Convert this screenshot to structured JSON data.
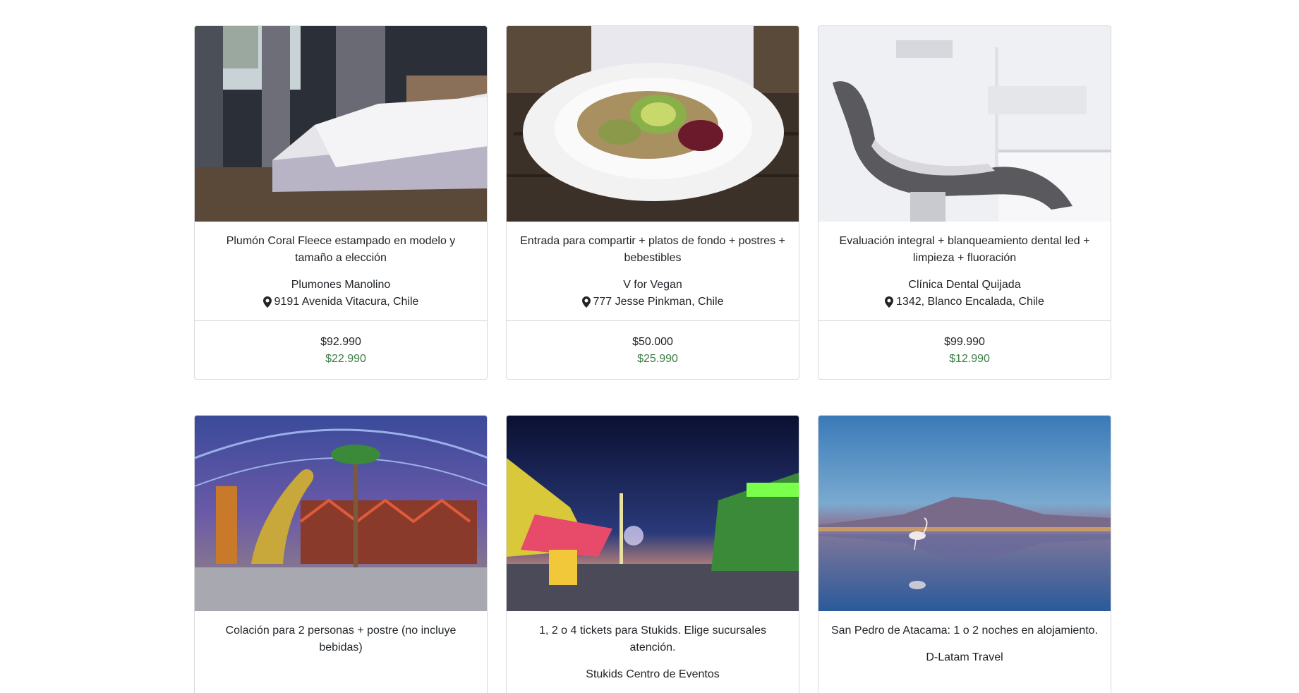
{
  "deals": [
    {
      "image": "bedroom-photo",
      "title": "Plumón Coral Fleece estampado en modelo y tamaño a elección",
      "merchant": "Plumones Manolino",
      "location": "9191 Avenida Vitacura, Chile",
      "price_old": "$92.990",
      "price_new": "$22.990"
    },
    {
      "image": "vegan-salad-photo",
      "title": "Entrada para compartir + platos de fondo + postres + bebestibles",
      "merchant": "V for Vegan",
      "location": "777 Jesse Pinkman, Chile",
      "price_old": "$50.000",
      "price_new": "$25.990"
    },
    {
      "image": "dental-chair-photo",
      "title": "Evaluación integral + blanqueamiento dental led + limpieza + fluoración",
      "merchant": "Clínica Dental Quijada",
      "location": "1342, Blanco Encalada, Chile",
      "price_old": "$99.990",
      "price_new": "$12.990"
    },
    {
      "image": "dinosaur-theme-park-photo",
      "title": "Colación para 2 personas + postre (no incluye bebidas)"
    },
    {
      "image": "night-fair-photo",
      "title": "1, 2 o 4 tickets para Stukids. Elige sucursales atención.",
      "merchant": "Stukids Centro de Eventos"
    },
    {
      "image": "flamingo-salt-flat-photo",
      "title": "San Pedro de Atacama: 1 o 2 noches en alojamiento.",
      "merchant": "D-Latam Travel"
    }
  ],
  "colors": {
    "price_new": "#3a7d44",
    "border": "#d9d9d9"
  }
}
